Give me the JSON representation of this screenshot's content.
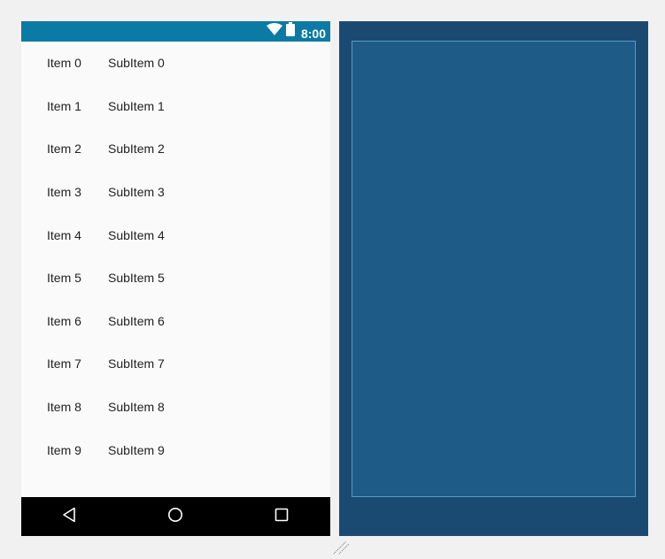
{
  "status_bar": {
    "time": "8:00",
    "icons": [
      "wifi-icon",
      "battery-icon"
    ],
    "color": "#0b7aa5"
  },
  "list": {
    "items": [
      {
        "title": "Item 0",
        "subtitle": "SubItem 0"
      },
      {
        "title": "Item 1",
        "subtitle": "SubItem 1"
      },
      {
        "title": "Item 2",
        "subtitle": "SubItem 2"
      },
      {
        "title": "Item 3",
        "subtitle": "SubItem 3"
      },
      {
        "title": "Item 4",
        "subtitle": "SubItem 4"
      },
      {
        "title": "Item 5",
        "subtitle": "SubItem 5"
      },
      {
        "title": "Item 6",
        "subtitle": "SubItem 6"
      },
      {
        "title": "Item 7",
        "subtitle": "SubItem 7"
      },
      {
        "title": "Item 8",
        "subtitle": "SubItem 8"
      },
      {
        "title": "Item 9",
        "subtitle": "SubItem 9"
      }
    ]
  },
  "nav_bar": {
    "buttons": [
      "back-icon",
      "home-icon",
      "recents-icon"
    ]
  },
  "blueprint": {
    "background": "#1a4a72",
    "inner": "#1e5b87"
  }
}
